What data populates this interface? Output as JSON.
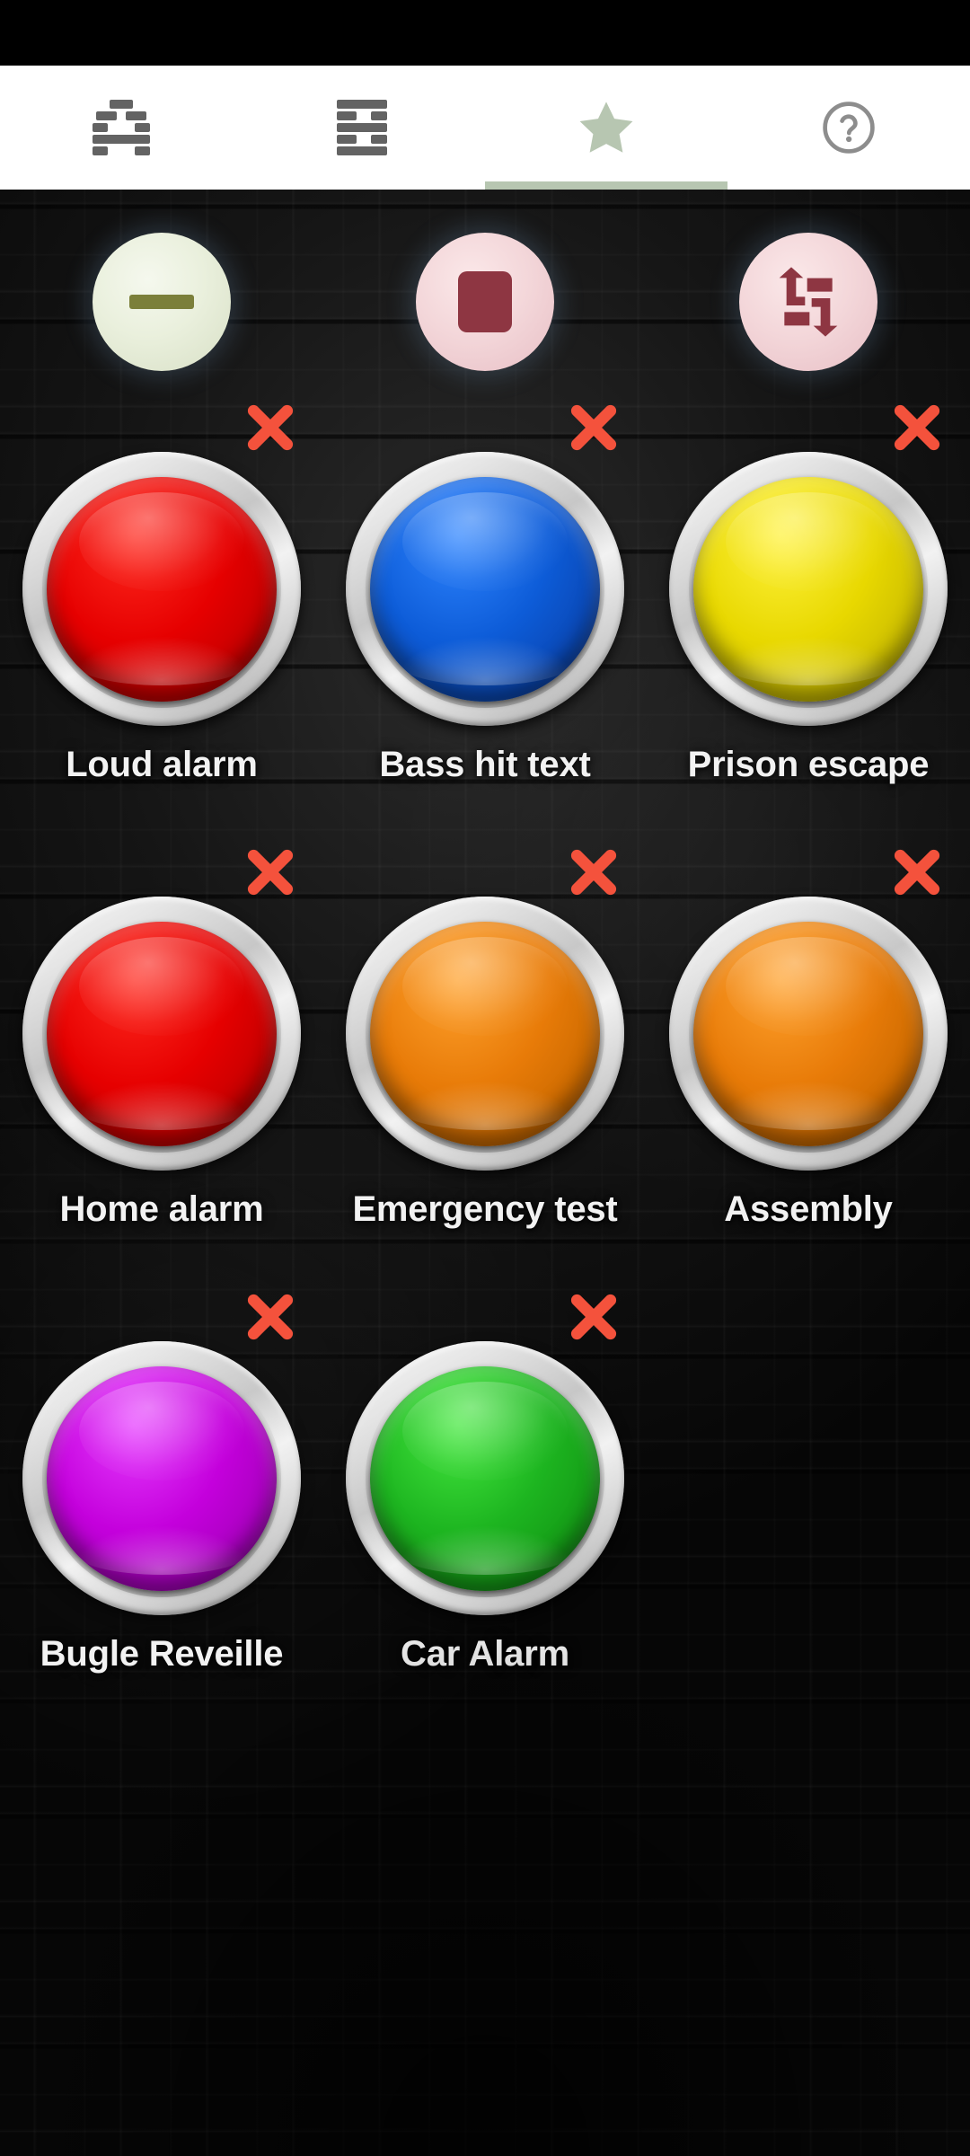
{
  "app": {
    "background": "#0a0a0a",
    "accent": "#b7c6b1"
  },
  "tabs": [
    {
      "id": "tab-tunnel",
      "icon": "brick-arch-icon",
      "label": "Tunnel",
      "active": false
    },
    {
      "id": "tab-wall",
      "icon": "brick-wall-icon",
      "label": "Wall",
      "active": false
    },
    {
      "id": "tab-favorites",
      "icon": "star-icon",
      "label": "Favorites",
      "active": true
    },
    {
      "id": "tab-help",
      "icon": "help-circle-icon",
      "label": "Help",
      "active": false
    }
  ],
  "controls": [
    {
      "id": "minus-button",
      "icon": "minus-icon",
      "label": "Volume down",
      "face": "#eaf0dd",
      "glyph_color": "#7b7f3a"
    },
    {
      "id": "stop-button",
      "icon": "stop-icon",
      "label": "Stop",
      "face": "#f3d6d9",
      "glyph_color": "#8e3642"
    },
    {
      "id": "repeat-button",
      "icon": "repeat-icon",
      "label": "Repeat",
      "face": "#f3d6d9",
      "glyph_color": "#8e3642"
    }
  ],
  "sounds": {
    "delete_badge_icon": "close-x-icon",
    "delete_badge_color": "#f4523c",
    "items": [
      {
        "label": "Loud alarm",
        "color": "#e60000",
        "color_light": "#ff2a1f",
        "color_dark": "#a30000",
        "deletable": true
      },
      {
        "label": "Bass hit text",
        "color": "#0d5cd8",
        "color_light": "#2f85ff",
        "color_dark": "#08349c",
        "deletable": true
      },
      {
        "label": "Prison escape",
        "color": "#e8d800",
        "color_light": "#fff23d",
        "color_dark": "#a59900",
        "deletable": true
      },
      {
        "label": "Home alarm",
        "color": "#e60000",
        "color_light": "#ff2a1f",
        "color_dark": "#a30000",
        "deletable": true
      },
      {
        "label": "Emergency test",
        "color": "#e87b08",
        "color_light": "#ffa22e",
        "color_dark": "#a85400",
        "deletable": true
      },
      {
        "label": "Assembly",
        "color": "#e87b08",
        "color_light": "#ffa22e",
        "color_dark": "#a85400",
        "deletable": true
      },
      {
        "label": "Bugle Reveille",
        "color": "#c400dc",
        "color_light": "#e63dff",
        "color_dark": "#8a009c",
        "deletable": true
      },
      {
        "label": "Car Alarm",
        "color": "#1db520",
        "color_light": "#45e83f",
        "color_dark": "#0d7d12",
        "deletable": true
      }
    ]
  }
}
